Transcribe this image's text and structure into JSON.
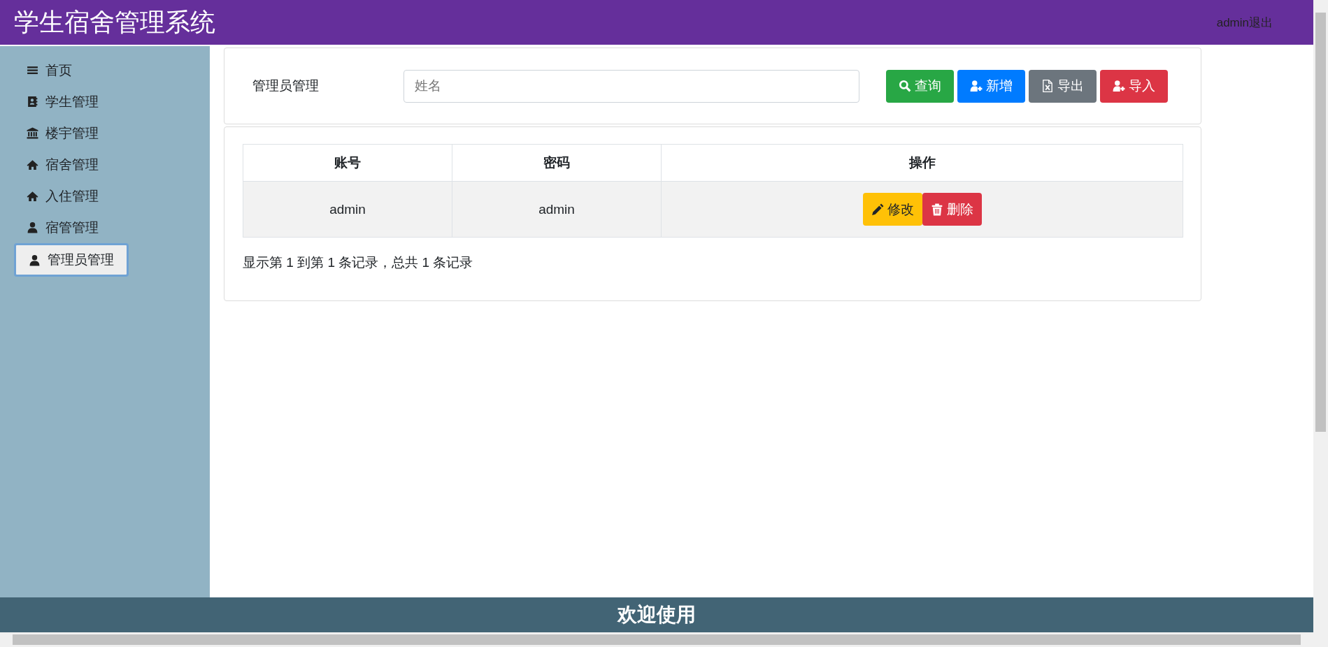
{
  "header": {
    "title": "学生宿舍管理系统",
    "logout": "admin退出"
  },
  "sidebar": {
    "items": [
      {
        "label": "首页",
        "kind": "menu",
        "selected": false
      },
      {
        "label": "学生管理",
        "kind": "contact",
        "selected": false
      },
      {
        "label": "楼宇管理",
        "kind": "bank",
        "selected": false
      },
      {
        "label": "宿舍管理",
        "kind": "home",
        "selected": false
      },
      {
        "label": "入住管理",
        "kind": "home",
        "selected": false
      },
      {
        "label": "宿管管理",
        "kind": "user",
        "selected": false
      },
      {
        "label": "管理员管理",
        "kind": "user",
        "selected": true
      }
    ]
  },
  "search": {
    "label": "管理员管理",
    "placeholder": "姓名"
  },
  "actions": [
    {
      "label": "查询",
      "kind": "search"
    },
    {
      "label": "新增",
      "kind": "add"
    },
    {
      "label": "导出",
      "kind": "export"
    },
    {
      "label": "导入",
      "kind": "import"
    }
  ],
  "table": {
    "columns": [
      "账号",
      "密码",
      "操作"
    ],
    "rows": [
      {
        "cells": [
          "admin",
          "admin"
        ],
        "actions": [
          {
            "label": "修改",
            "kind": "edit"
          },
          {
            "label": "删除",
            "kind": "delete"
          }
        ]
      }
    ]
  },
  "pagination_info": "显示第 1 到第 1 条记录，总共 1 条记录",
  "footer": "欢迎使用"
}
